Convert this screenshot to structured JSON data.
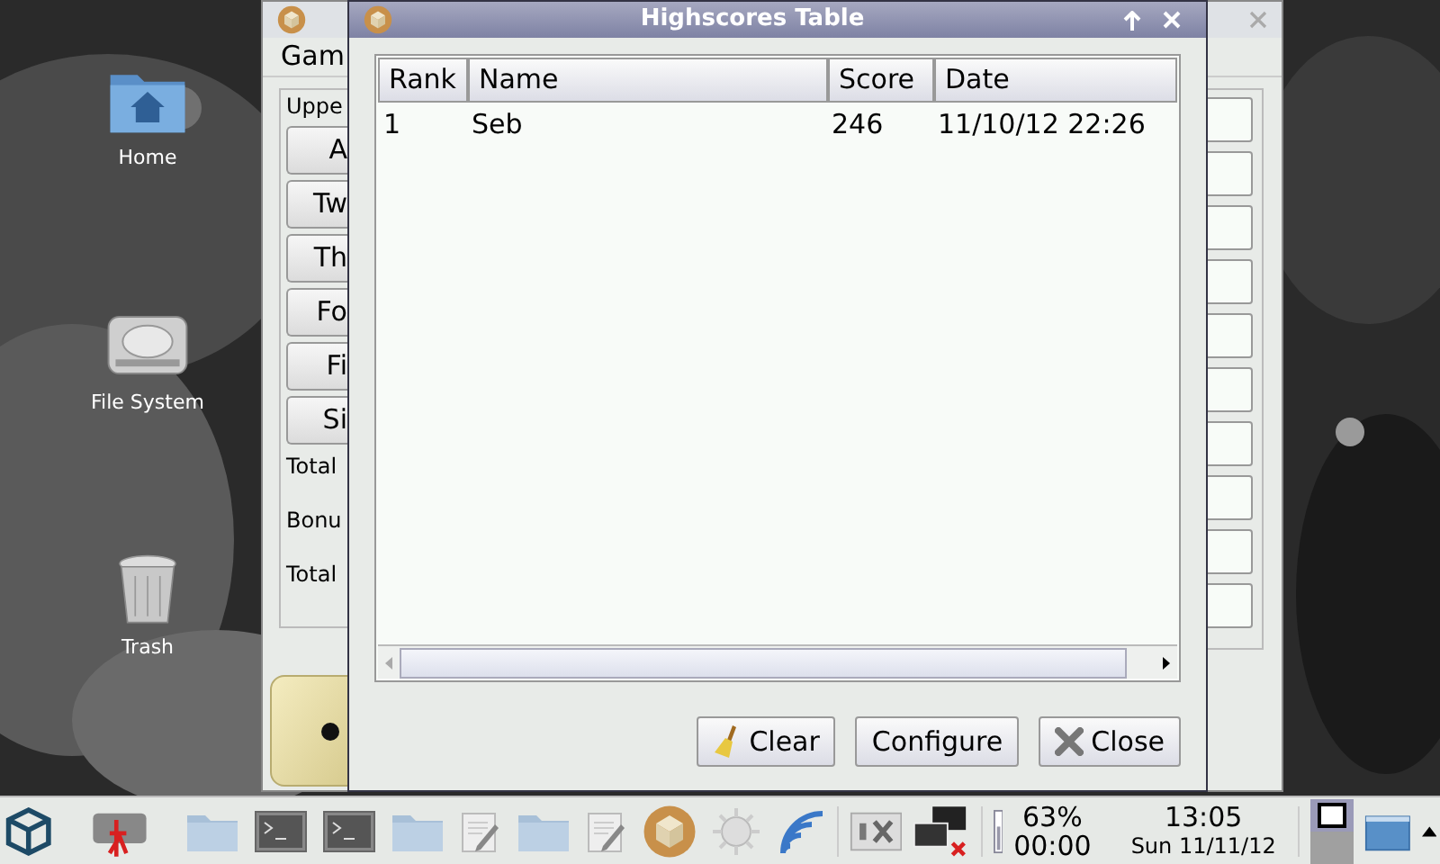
{
  "desktop_icons": [
    {
      "kind": "home",
      "label": "Home"
    },
    {
      "kind": "drive",
      "label": "File System"
    },
    {
      "kind": "trash",
      "label": "Trash"
    }
  ],
  "background_window": {
    "menu": "Gam",
    "group_title": "Uppe",
    "buttons": [
      "A",
      "Tw",
      "Th",
      "Fo",
      "Fi",
      "Si"
    ],
    "labels": [
      "Total",
      "Bonu",
      "Total"
    ]
  },
  "dialog": {
    "title": "Highscores Table",
    "table": {
      "columns": [
        "Rank",
        "Name",
        "Score",
        "Date"
      ],
      "rows": [
        [
          "1",
          "Seb",
          "246",
          "11/10/12 22:26"
        ]
      ]
    },
    "buttons": [
      {
        "kind": "clear",
        "label": "Clear"
      },
      {
        "kind": "plain",
        "label": "Configure"
      },
      {
        "kind": "close",
        "label": "Close"
      }
    ]
  },
  "taskbar": {
    "battery_percent": "63%",
    "battery_time": "00:00",
    "time": "13:05",
    "date": "Sun 11/11/12"
  }
}
